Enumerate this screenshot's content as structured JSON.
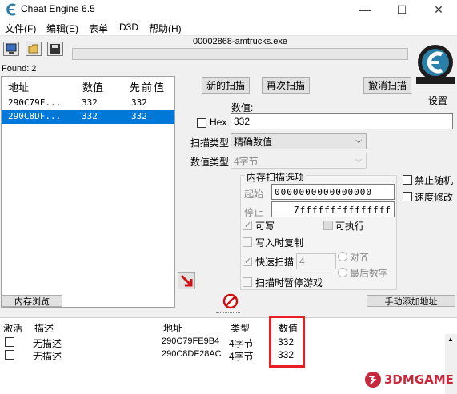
{
  "window": {
    "title": "Cheat Engine 6.5",
    "minimize": "—",
    "maximize": "☐",
    "close": "✕"
  },
  "menu": [
    "文件(F)",
    "编辑(E)",
    "表单",
    "D3D",
    "帮助(H)"
  ],
  "process": "00002868-amtrucks.exe",
  "found": "Found: 2",
  "results": {
    "headers": [
      "地址",
      "数值",
      "先前值"
    ],
    "rows": [
      {
        "address": "290C79F...",
        "value": "332",
        "previous": "332",
        "selected": false
      },
      {
        "address": "290C8DF...",
        "value": "332",
        "previous": "332",
        "selected": true
      }
    ]
  },
  "buttons": {
    "new_scan": "新的扫描",
    "next_scan": "再次扫描",
    "undo_scan": "撤消扫描",
    "settings": "设置",
    "memory_view": "内存浏览",
    "add_address": "手动添加地址"
  },
  "scan": {
    "value_label": "数值:",
    "hex_label": "Hex",
    "value": "332",
    "scan_type_label": "扫描类型",
    "scan_type": "精确数值",
    "value_type_label": "数值类型",
    "value_type": "4字节"
  },
  "memory_options": {
    "title": "内存扫描选项",
    "start_label": "起始",
    "start": "0000000000000000",
    "stop_label": "停止",
    "stop": "7fffffffffffffff",
    "writable": "可写",
    "executable": "可执行",
    "copy_on_write": "写入时复制",
    "fast_scan": "快速扫描",
    "fast_scan_value": "4",
    "align": "对齐",
    "last_digits": "最后数字",
    "pause_game": "扫描时暂停游戏"
  },
  "extra": {
    "disable_random": "禁止随机",
    "speed_hack": "速度修改"
  },
  "address_list": {
    "headers": [
      "激活",
      "描述",
      "地址",
      "类型",
      "数值"
    ],
    "rows": [
      {
        "description": "无描述",
        "address": "290C79FE9B4",
        "type": "4字节",
        "value": "332"
      },
      {
        "description": "无描述",
        "address": "290C8DF28AC",
        "type": "4字节",
        "value": "332"
      }
    ]
  },
  "watermark": "3DMGAME",
  "colors": {
    "selection": "#0078d7",
    "highlight_box": "#e81e25",
    "logo": "#2a7fa8"
  }
}
